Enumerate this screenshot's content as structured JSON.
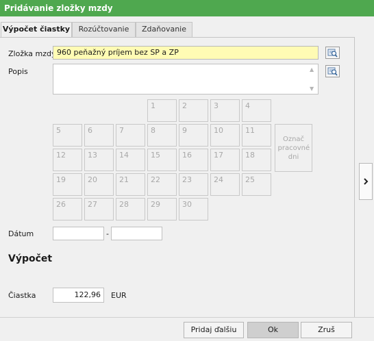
{
  "window": {
    "title": "Pridávanie zložky mzdy"
  },
  "tabs": [
    {
      "label": "Výpočet čiastky",
      "active": true
    },
    {
      "label": "Rozúčtovanie",
      "active": false
    },
    {
      "label": "Zdaňovanie",
      "active": false
    }
  ],
  "form": {
    "component_label": "Zložka mzdy",
    "component_value": "960  peňažný príjem bez SP a ZP",
    "description_label": "Popis",
    "description_value": "",
    "date_label": "Dátum",
    "date_from": "",
    "date_sep": "-",
    "date_to": ""
  },
  "calendar": {
    "days": [
      "1",
      "2",
      "3",
      "4",
      "5",
      "6",
      "7",
      "8",
      "9",
      "10",
      "11",
      "12",
      "13",
      "14",
      "15",
      "16",
      "17",
      "18",
      "19",
      "20",
      "21",
      "22",
      "23",
      "24",
      "25",
      "26",
      "27",
      "28",
      "29",
      "30"
    ],
    "mark_workdays_label": "Označ pracovné dni"
  },
  "calculation": {
    "title": "Výpočet",
    "amount_label": "Čiastka",
    "amount_value": "122,96",
    "currency": "EUR"
  },
  "buttons": {
    "add_next": "Pridaj ďalšiu",
    "ok": "Ok",
    "cancel": "Zruš"
  },
  "icons": {
    "lookup": "magnifier-lookup-icon",
    "side_toggle": "chevron-right-icon",
    "scroll_up": "scroll-up-arrow-icon",
    "scroll_down": "scroll-down-arrow-icon"
  },
  "colors": {
    "titlebar": "#4fa84f",
    "highlight_field": "#fffbb4"
  }
}
